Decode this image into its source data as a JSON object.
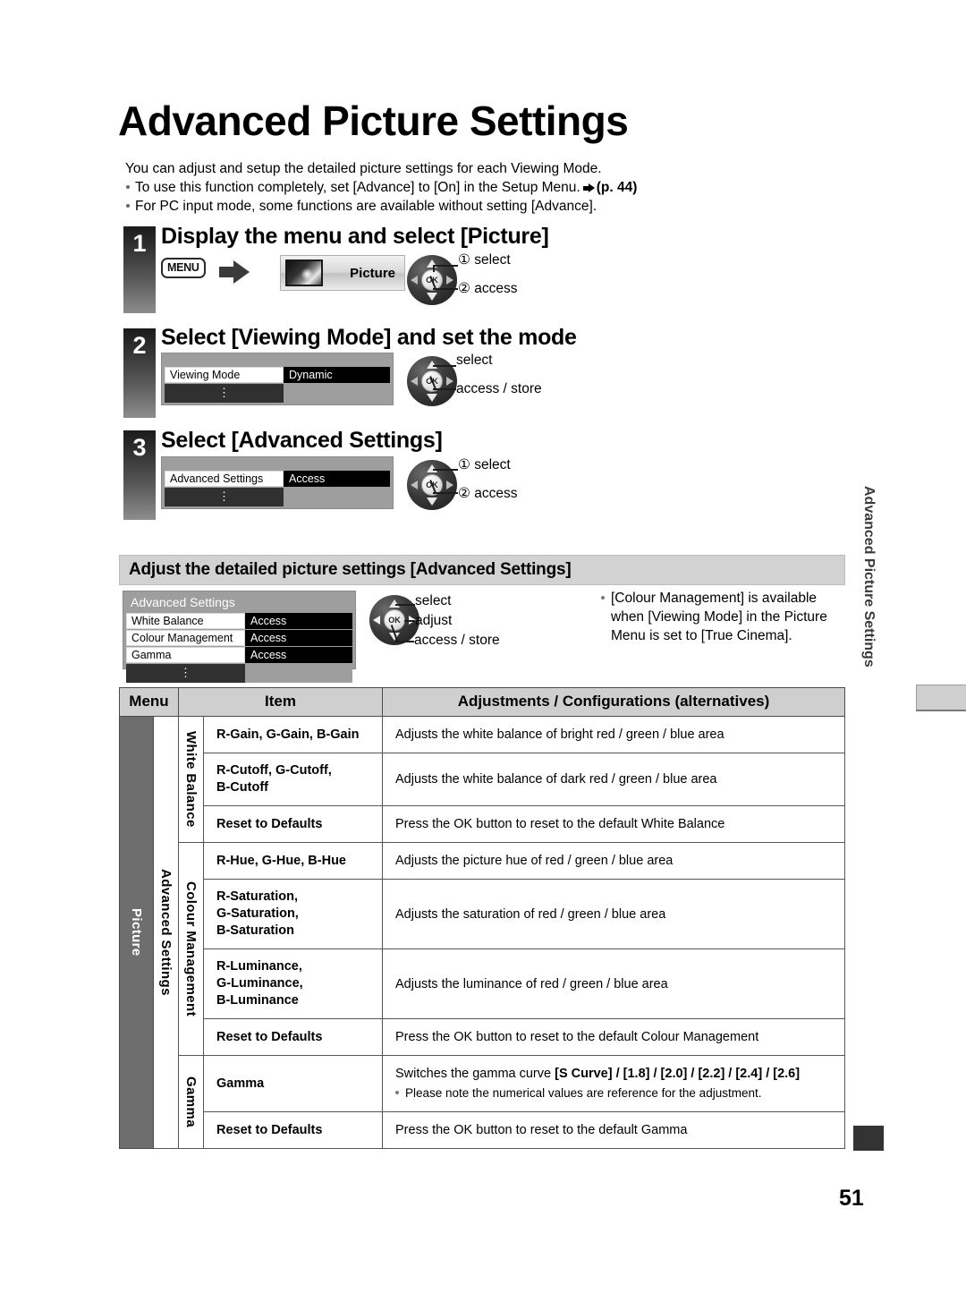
{
  "page": {
    "title": "Advanced Picture Settings",
    "number": "51",
    "side_tab_label": "Advanced Picture Settings"
  },
  "intro": {
    "line1": "You can adjust and setup the detailed picture settings for each Viewing Mode.",
    "bullet1_pre": "To use this function completely, set [Advance] to [On] in the Setup Menu.",
    "bullet1_ref": "(p. 44)",
    "bullet2": "For PC input mode, some functions are available without setting [Advance]."
  },
  "steps": [
    {
      "num": "1",
      "heading": "Display the menu and select [Picture]",
      "menu_key": "MENU",
      "chip_label": "Picture",
      "callouts": [
        "① select",
        "② access"
      ]
    },
    {
      "num": "2",
      "heading": "Select [Viewing Mode] and set the mode",
      "osd": {
        "rows": [
          {
            "key": "Viewing Mode",
            "value": "Dynamic"
          }
        ]
      },
      "callouts": [
        "select",
        "access / store"
      ]
    },
    {
      "num": "3",
      "heading": "Select [Advanced Settings]",
      "osd": {
        "rows": [
          {
            "key": "Advanced Settings",
            "value": "Access"
          }
        ]
      },
      "callouts": [
        "① select",
        "② access"
      ]
    }
  ],
  "section": {
    "band_title": "Adjust the detailed picture settings [Advanced Settings]",
    "osd": {
      "title": "Advanced Settings",
      "rows": [
        {
          "key": "White Balance",
          "value": "Access"
        },
        {
          "key": "Colour Management",
          "value": "Access"
        },
        {
          "key": "Gamma",
          "value": "Access"
        }
      ]
    },
    "callouts": [
      "select",
      "adjust",
      "access / store"
    ],
    "note": "[Colour Management] is available when [Viewing Mode] in the Picture Menu is set to [True Cinema]."
  },
  "table": {
    "headers": {
      "menu": "Menu",
      "item": "Item",
      "adjustments": "Adjustments / Configurations (alternatives)"
    },
    "menu_label": "Picture",
    "group_label": "Advanced Settings",
    "groups": [
      {
        "label": "White Balance",
        "rows": [
          {
            "item": "R-Gain, G-Gain, B-Gain",
            "desc": "Adjusts the white balance of bright red / green / blue area"
          },
          {
            "item": "R-Cutoff, G-Cutoff,\nB-Cutoff",
            "desc": "Adjusts the white balance of dark red / green / blue area"
          },
          {
            "item": "Reset to Defaults",
            "desc": "Press the OK button to reset to the default White Balance"
          }
        ]
      },
      {
        "label": "Colour Management",
        "rows": [
          {
            "item": "R-Hue, G-Hue, B-Hue",
            "desc": "Adjusts the picture hue of red / green / blue area"
          },
          {
            "item": "R-Saturation,\nG-Saturation,\nB-Saturation",
            "desc": "Adjusts the saturation of red / green / blue area"
          },
          {
            "item": "R-Luminance,\nG-Luminance,\nB-Luminance",
            "desc": "Adjusts the luminance of red / green / blue area"
          },
          {
            "item": "Reset to Defaults",
            "desc": "Press the OK button to reset to the default Colour Management"
          }
        ]
      },
      {
        "label": "Gamma",
        "rows": [
          {
            "item": "Gamma",
            "desc": "Switches the gamma curve",
            "desc_bold": "[S Curve] / [1.8] / [2.0] / [2.2] / [2.4] / [2.6]",
            "sub": "Please note the numerical values are reference for the adjustment."
          },
          {
            "item": "Reset to Defaults",
            "desc": "Press the OK button to reset to the default Gamma"
          }
        ]
      }
    ]
  }
}
